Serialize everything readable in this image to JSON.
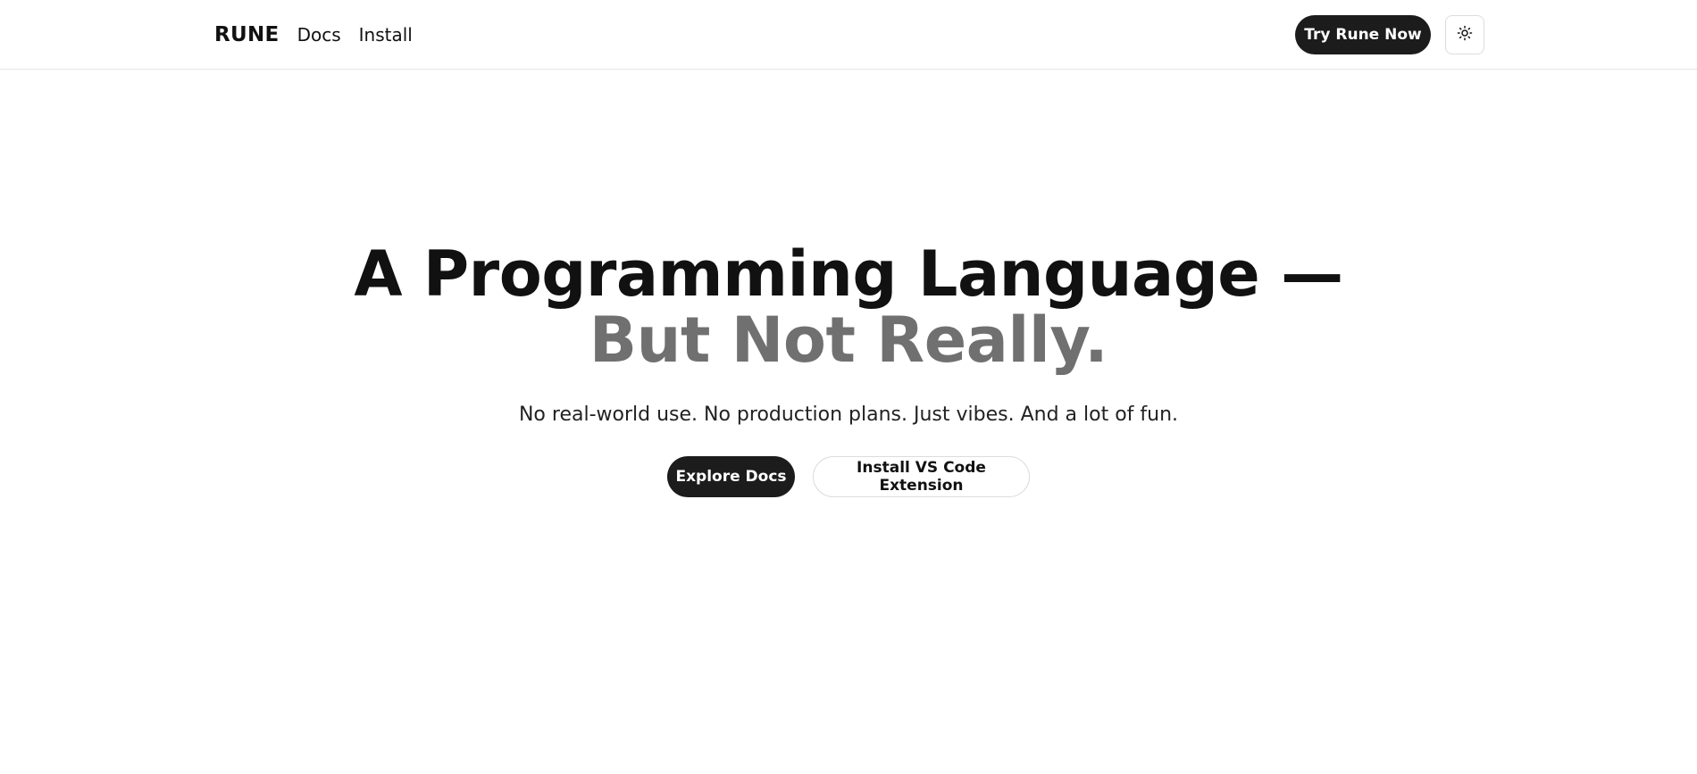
{
  "nav": {
    "brand": "RUNE",
    "links": [
      {
        "label": "Docs"
      },
      {
        "label": "Install"
      }
    ],
    "cta_label": "Try Rune Now",
    "theme_toggle_icon": "sun-icon"
  },
  "hero": {
    "headline_line1": "A Programming Language —",
    "headline_line2": "But Not Really.",
    "subtitle": "No real-world use. No production plans. Just vibes. And a lot of fun.",
    "primary_button": "Explore Docs",
    "secondary_button": "Install VS Code Extension"
  },
  "colors": {
    "background": "#ffffff",
    "primary_text": "#111111",
    "muted_headline": "#707070",
    "button_dark": "#1c1c1c",
    "border": "#dcdcdc"
  }
}
